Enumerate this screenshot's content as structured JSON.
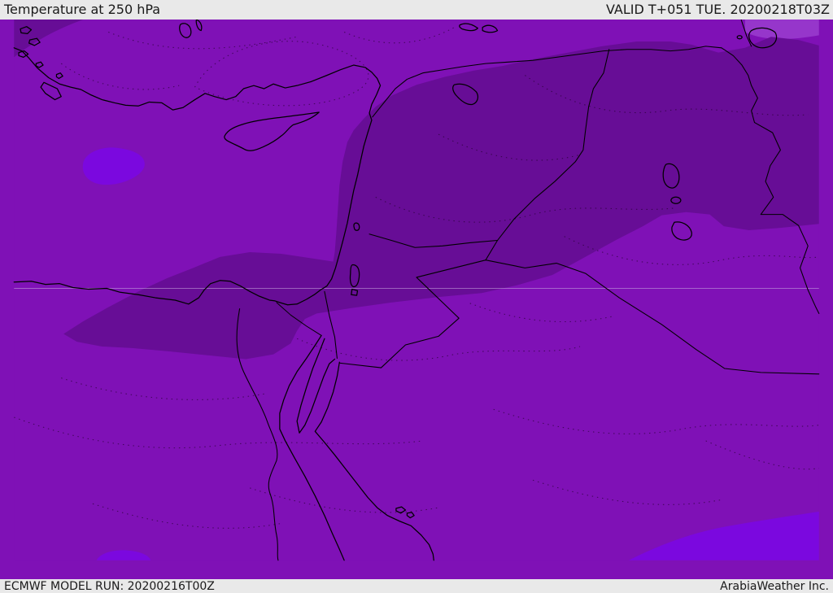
{
  "header": {
    "title": "Temperature at 250 hPa",
    "validity": "VALID T+051 TUE. 20200218T03Z"
  },
  "footer": {
    "model_run": "ECMWF MODEL RUN: 20200216T00Z",
    "brand": "ArabiaWeather Inc."
  },
  "map": {
    "description": "ECMWF 250 hPa temperature forecast shading over the Eastern Mediterranean and Middle East",
    "colors": {
      "base_fill": "#7F11B6",
      "cold_band_fill": "#670D96",
      "coldest_patch_fill": "#7B08DF",
      "warm_wedge_fill": "#9636CB",
      "outline": "#000000",
      "isotherm_dots": "#1A0020",
      "latitude_gridline": "#C9A9E0",
      "bar_background": "#E9E9E9",
      "bar_text": "#1A1A1A"
    }
  }
}
